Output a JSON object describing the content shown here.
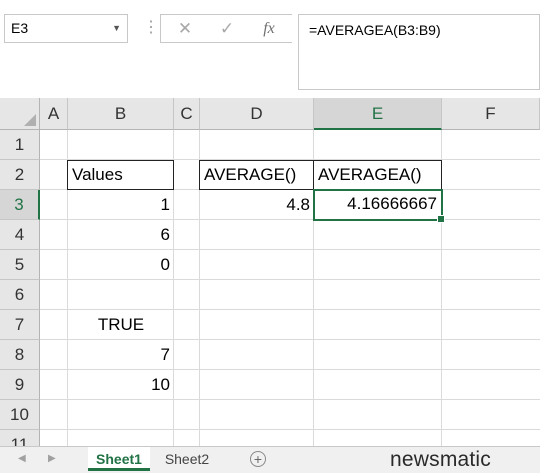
{
  "name_box": "E3",
  "formula_bar": {
    "cancel_glyph": "✕",
    "enter_glyph": "✓",
    "fx_label": "fx",
    "formula": "=AVERAGEA(B3:B9)"
  },
  "columns": [
    "A",
    "B",
    "C",
    "D",
    "E",
    "F"
  ],
  "rows": [
    "1",
    "2",
    "3",
    "4",
    "5",
    "6",
    "7",
    "8",
    "9",
    "10",
    "11"
  ],
  "cells": {
    "B2": "Values",
    "D2": "AVERAGE()",
    "E2": "AVERAGEA()",
    "B3": "1",
    "D3": "4.8",
    "E3": "4.16666667",
    "B4": "6",
    "B5": "0",
    "B7": "TRUE",
    "B8": "7",
    "B9": "10"
  },
  "sheets": {
    "tabs": [
      "Sheet1",
      "Sheet2"
    ],
    "active": "Sheet1",
    "add_glyph": "+"
  },
  "watermark": "newsmatic",
  "colors": {
    "accent": "#217346"
  }
}
